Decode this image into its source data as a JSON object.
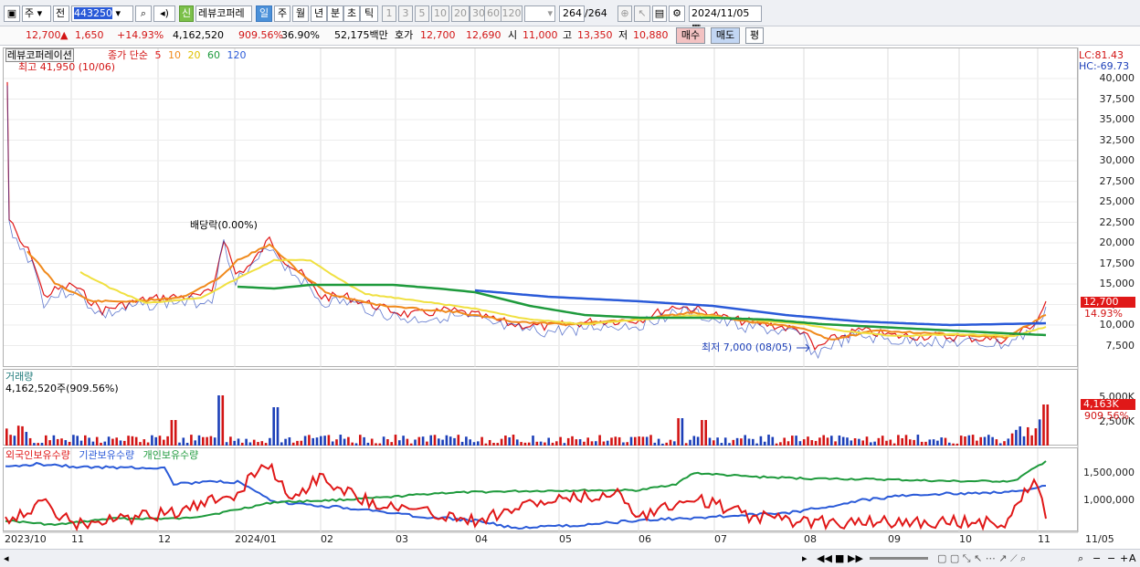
{
  "toolbar": {
    "market_type": "주",
    "prefix": "전",
    "code": "443250",
    "stock_badge": "신",
    "stock_name": "레뷰코퍼레",
    "periods": [
      "일",
      "주",
      "월",
      "년",
      "분",
      "초",
      "틱"
    ],
    "active_period": "일",
    "intervals": [
      "1",
      "3",
      "5",
      "10",
      "20",
      "30",
      "60",
      "120"
    ],
    "count_value": "264",
    "count_total": "/264",
    "date": "2024/11/05"
  },
  "quote": {
    "price": "12,700",
    "change": "1,650",
    "change_pct": "+14.93%",
    "volume": "4,162,520",
    "vol_ratio": "909.56%",
    "turnover": "36.90%",
    "amount": "52,175백만",
    "bid_label": "호가",
    "ask": "12,700",
    "bid": "12,690",
    "open_label": "시",
    "open": "11,000",
    "high_label": "고",
    "high": "13,350",
    "low_label": "저",
    "low": "10,880",
    "buy_label": "매수",
    "sell_label": "매도",
    "avg_label": "평"
  },
  "price_panel": {
    "stock_label": "레뷰코퍼레이션",
    "ma_label": "종가 단순",
    "ma_periods": [
      "5",
      "10",
      "20",
      "60",
      "120"
    ],
    "ma_colors": [
      "#e01818",
      "#f08a1c",
      "#f0e040",
      "#1e9a3c",
      "#2a5ad8"
    ],
    "high_note": "최고 41,950 (10/06)",
    "dividend_note": "배당락(0.00%)",
    "low_note": "최저 7,000 (08/05)",
    "lc": "LC:81.43",
    "hc": "HC:-69.73",
    "y_ticks": [
      "40,000",
      "37,500",
      "35,000",
      "32,500",
      "30,000",
      "27,500",
      "25,000",
      "22,500",
      "20,000",
      "17,500",
      "15,000",
      "12,500",
      "10,000",
      "7,500"
    ],
    "current_tag": "12,700",
    "current_pct": "14.93%"
  },
  "volume_panel": {
    "title": "거래량",
    "value_label": "4,162,520주(909.56%)",
    "y_ticks": [
      "5,000K",
      "2,500K"
    ],
    "current_tag": "4,163K",
    "current_pct": "909.56%"
  },
  "holdings_panel": {
    "legend": [
      "외국인보유수량",
      "기관보유수량",
      "개인보유수량"
    ],
    "colors": [
      "#e01818",
      "#2a5ad8",
      "#1e9a3c"
    ],
    "y_ticks": [
      "1,500,000",
      "1,000,000"
    ]
  },
  "x_labels": [
    "2023/10",
    "11",
    "12",
    "2024/01",
    "02",
    "03",
    "04",
    "05",
    "06",
    "07",
    "08",
    "09",
    "10",
    "11",
    "11/05"
  ]
}
